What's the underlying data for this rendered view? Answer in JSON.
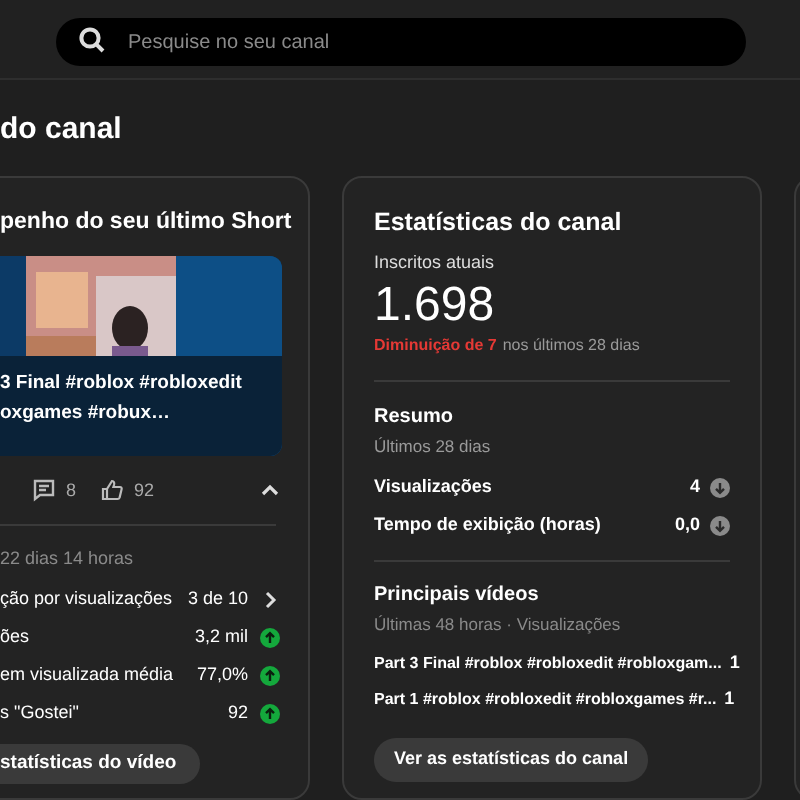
{
  "search": {
    "placeholder": "Pesquise no seu canal"
  },
  "heading": "do canal",
  "short_card": {
    "title": "penho do seu último Short",
    "overlay_lines": [
      "3 Final #roblox #robloxedit",
      "oxgames #robux…"
    ],
    "comments": "8",
    "likes": "92",
    "expanded": true,
    "age": "22 dias 14 horas",
    "rows": [
      {
        "label": "ção por visualizações",
        "value": "3 de 10",
        "kind": "link"
      },
      {
        "label": "ões",
        "value": "3,2 mil",
        "kind": "up"
      },
      {
        "label": "em visualizada média",
        "value": "77,0%",
        "kind": "up"
      },
      {
        "label": "s \"Gostei\"",
        "value": "92",
        "kind": "up"
      }
    ],
    "button": "statísticas do vídeo"
  },
  "channel_card": {
    "title": "Estatísticas do canal",
    "subscribers_label": "Inscritos atuais",
    "subscribers": "1.698",
    "change": "Diminuição de 7",
    "change_suffix": "nos últimos 28 dias",
    "summary_title": "Resumo",
    "summary_period": "Últimos 28 dias",
    "summary_rows": [
      {
        "label": "Visualizações",
        "value": "4",
        "kind": "down"
      },
      {
        "label": "Tempo de exibição (horas)",
        "value": "0,0",
        "kind": "down"
      }
    ],
    "top_title": "Principais vídeos",
    "top_period": "Últimas 48 horas · Visualizações",
    "top_videos": [
      {
        "title": "Part 3 Final #roblox #robloxedit #robloxgam...",
        "views": "1"
      },
      {
        "title": "Part 1 #roblox #robloxedit #robloxgames #r...",
        "views": "1"
      }
    ],
    "button": "Ver as estatísticas do canal"
  }
}
